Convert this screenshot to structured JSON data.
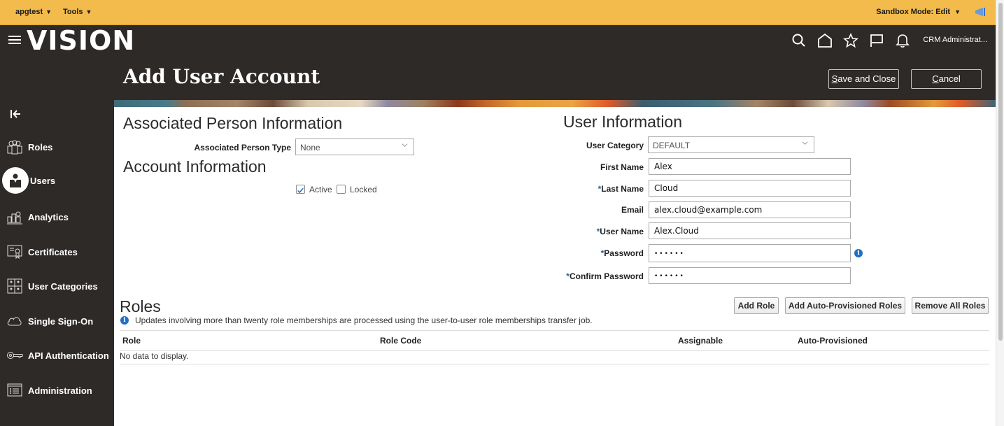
{
  "topbar": {
    "menus": [
      {
        "label": "apgtest",
        "caret": "▼"
      },
      {
        "label": "Tools",
        "caret": "▼"
      }
    ],
    "sandbox_label": "Sandbox Mode: Edit",
    "sandbox_caret": "▼",
    "flag_icon": "megaphone-icon"
  },
  "header": {
    "logo": "VISION",
    "icons": [
      "search-icon",
      "home-icon",
      "star-icon",
      "flag-icon",
      "bell-icon"
    ],
    "user": "CRM Administrat..."
  },
  "page": {
    "title": "Add User Account",
    "save_close_prefix": "S",
    "save_close_rest": "ave and Close",
    "cancel_prefix": "C",
    "cancel_rest": "ancel"
  },
  "sidebar": {
    "collapse_icon": "collapse-left-icon",
    "items": [
      {
        "label": "Roles",
        "icon": "roles-icon",
        "active": false
      },
      {
        "label": "Users",
        "icon": "user-icon",
        "active": true
      },
      {
        "label": "Analytics",
        "icon": "analytics-icon",
        "active": false
      },
      {
        "label": "Certificates",
        "icon": "certificate-icon",
        "active": false
      },
      {
        "label": "User Categories",
        "icon": "user-categories-icon",
        "active": false
      },
      {
        "label": "Single Sign-On",
        "icon": "cloud-icon",
        "active": false
      },
      {
        "label": "API Authentication",
        "icon": "key-icon",
        "active": false
      },
      {
        "label": "Administration",
        "icon": "administration-icon",
        "active": false
      }
    ]
  },
  "associated_person": {
    "heading": "Associated Person Information",
    "type_label": "Associated Person Type",
    "type_value": "None"
  },
  "account_info": {
    "heading": "Account Information",
    "active_label": "Active",
    "active_checked": true,
    "locked_label": "Locked",
    "locked_checked": false
  },
  "user_info": {
    "heading": "User Information",
    "required_mark": "*",
    "fields": {
      "user_category": {
        "label": "User Category",
        "value": "DEFAULT",
        "required": false
      },
      "first_name": {
        "label": "First Name",
        "value": "Alex",
        "required": false
      },
      "last_name": {
        "label": "Last Name",
        "value": "Cloud",
        "required": true
      },
      "email": {
        "label": "Email",
        "value": "alex.cloud@example.com",
        "required": false
      },
      "user_name": {
        "label": "User Name",
        "value": "Alex.Cloud",
        "required": true
      },
      "password": {
        "label": "Password",
        "value": "••••••",
        "required": true
      },
      "confirm_password": {
        "label": "Confirm Password",
        "value": "••••••",
        "required": true
      }
    },
    "password_info_icon": "i"
  },
  "roles": {
    "heading": "Roles",
    "info_icon": "i",
    "notice": "Updates involving more than twenty role memberships are processed using the user-to-user role memberships transfer job.",
    "buttons": {
      "add_role": "Add Role",
      "add_auto": "Add Auto-Provisioned Roles",
      "remove_all": "Remove All Roles"
    },
    "columns": [
      "Role",
      "Role Code",
      "Assignable",
      "Auto-Provisioned"
    ],
    "rows": [],
    "empty_text": "No data to display."
  },
  "colors": {
    "topbar": "#f2bb4c",
    "header": "#2d2a28",
    "accent_blue": "#1f6fc5",
    "required_blue": "#2f5e9a"
  }
}
